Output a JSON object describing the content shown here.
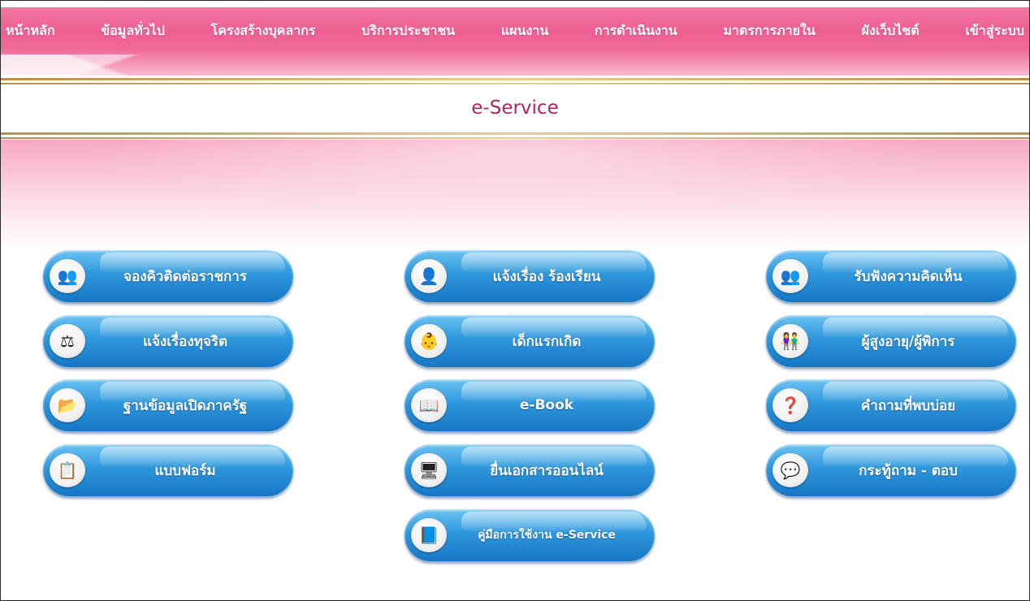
{
  "nav": {
    "items": [
      {
        "id": "home",
        "label": "หน้าหลัก"
      },
      {
        "id": "general",
        "label": "ข้อมูลทั่วไป"
      },
      {
        "id": "staff",
        "label": "โครงสร้างบุคลากร"
      },
      {
        "id": "public",
        "label": "บริการประชาชน"
      },
      {
        "id": "plan",
        "label": "แผนงาน"
      },
      {
        "id": "operation",
        "label": "การดำเนินงาน"
      },
      {
        "id": "internal",
        "label": "มาตรการภายใน"
      },
      {
        "id": "sitemap",
        "label": "ผังเว็บไซต์"
      },
      {
        "id": "login",
        "label": "เข้าสู่ระบบ"
      }
    ]
  },
  "page": {
    "title": "e-Service"
  },
  "services": {
    "col1": [
      {
        "label": "จองคิวติดต่อราชการ",
        "icon": "people-queue-icon",
        "glyph": "👥"
      },
      {
        "label": "แจ้งเรื่องทุจริต",
        "icon": "scales-icon",
        "glyph": "⚖"
      },
      {
        "label": "ฐานข้อมูลเปิดภาครัฐ",
        "icon": "open-folder-icon",
        "glyph": "📂"
      },
      {
        "label": "แบบฟอร์ม",
        "icon": "clipboard-form-icon",
        "glyph": "📋"
      }
    ],
    "col2": [
      {
        "label": "แจ้งเรื่อง ร้องเรียน",
        "icon": "person-complaint-icon",
        "glyph": "👤"
      },
      {
        "label": "เด็กแรกเกิด",
        "icon": "baby-icon",
        "glyph": "👶"
      },
      {
        "label": "e-Book",
        "icon": "ebook-icon",
        "glyph": "📖"
      },
      {
        "label": "ยื่นเอกสารออนไลน์",
        "icon": "computer-document-icon",
        "glyph": "🖥"
      },
      {
        "label": "คู่มือการใช้งาน e-Service",
        "icon": "manual-book-icon",
        "glyph": "📘"
      }
    ],
    "col3": [
      {
        "label": "รับฟังความคิดเห็น",
        "icon": "meeting-icon",
        "glyph": "👥"
      },
      {
        "label": "ผู้สูงอายุ/ผู้พิการ",
        "icon": "elderly-disabled-icon",
        "glyph": "👫"
      },
      {
        "label": "คำถามที่พบบ่อย",
        "icon": "faq-icon",
        "glyph": "❓"
      },
      {
        "label": "กระทู้ถาม - ตอบ",
        "icon": "qa-board-icon",
        "glyph": "💬"
      }
    ]
  },
  "colors": {
    "nav_pink": "#ee5f92",
    "title_magenta": "#b0245e",
    "button_blue": "#2f97dc",
    "gold": "#c9a461"
  }
}
